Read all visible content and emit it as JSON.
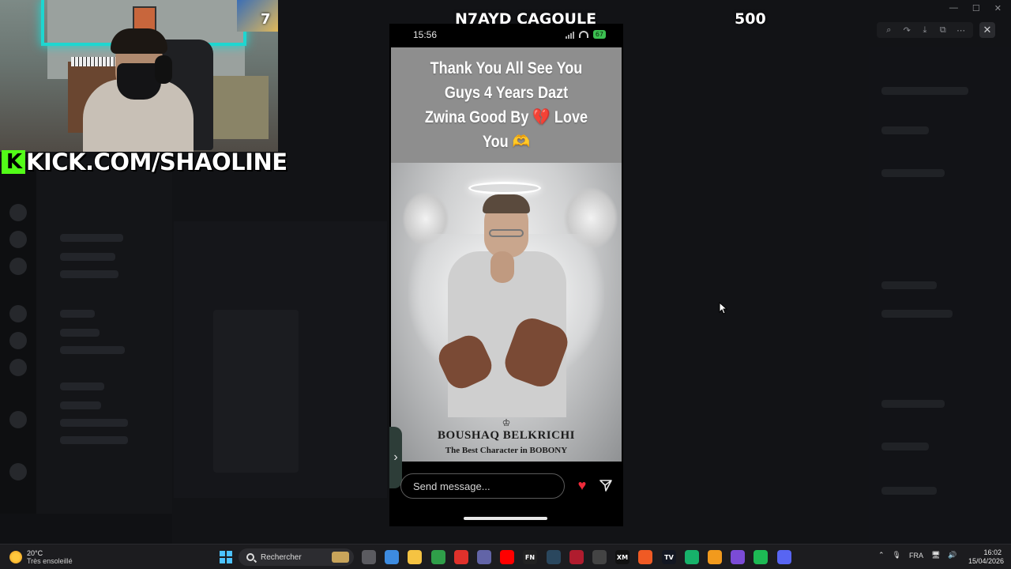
{
  "stream": {
    "title": "N7AYD CAGOULE",
    "count": "500",
    "webcam_badge": "7",
    "kick_logo": "K",
    "kick_url": "KICK.COM/SHAOLINE",
    "accent": "#53fc18"
  },
  "viewer": {
    "toolbar": [
      {
        "name": "zoom-icon",
        "glyph": "⌕"
      },
      {
        "name": "forward-icon",
        "glyph": "↷"
      },
      {
        "name": "download-icon",
        "glyph": "⤓"
      },
      {
        "name": "open-external-icon",
        "glyph": "⧉"
      },
      {
        "name": "more-icon",
        "glyph": "⋯"
      }
    ],
    "close_glyph": "✕"
  },
  "phone": {
    "status_time": "15:56",
    "battery": "67"
  },
  "story": {
    "caption": "Thank You All See You Guys 4 Years Dazt Zwina Good By 💔 Love You 🫶",
    "brand_crest": "♔",
    "brand_name": "BOUSHAQ BELKRICHI",
    "brand_subtitle": "The Best Character in BOBONY",
    "side_arrow": "›"
  },
  "message_bar": {
    "placeholder": "Send message...",
    "like_glyph": "♥",
    "like_color": "#ef2a3a"
  },
  "taskbar": {
    "weather_temp": "20°C",
    "weather_desc": "Très ensoleillé",
    "search_text": "Rechercher",
    "language": "FRA",
    "time": "16:02",
    "date": "15/04/2026",
    "tray_chevron": "⌃",
    "apps": [
      {
        "name": "task-view-icon",
        "color": "#5b5b60",
        "label": ""
      },
      {
        "name": "copilot-icon",
        "color": "#3d8be0",
        "label": ""
      },
      {
        "name": "file-explorer-icon",
        "color": "#f5c342",
        "label": ""
      },
      {
        "name": "chrome-icon",
        "color": "#2f9e49",
        "label": ""
      },
      {
        "name": "adobe-icon",
        "color": "#e0312b",
        "label": ""
      },
      {
        "name": "teams-icon",
        "color": "#6264a7",
        "label": ""
      },
      {
        "name": "youtube-icon",
        "color": "#ff0000",
        "label": ""
      },
      {
        "name": "app-fn-icon",
        "color": "#222",
        "label": "FN"
      },
      {
        "name": "steam-icon",
        "color": "#2a475e",
        "label": ""
      },
      {
        "name": "app-red-icon",
        "color": "#b01c2e",
        "label": ""
      },
      {
        "name": "app-refresh-icon",
        "color": "#444",
        "label": ""
      },
      {
        "name": "app-xm-icon",
        "color": "#111",
        "label": "XM"
      },
      {
        "name": "brave-icon",
        "color": "#f05a24",
        "label": ""
      },
      {
        "name": "tradingview-icon",
        "color": "#131722",
        "label": "TV"
      },
      {
        "name": "app-green-icon",
        "color": "#17b26a",
        "label": ""
      },
      {
        "name": "fl-studio-icon",
        "color": "#f29a1d",
        "label": ""
      },
      {
        "name": "obs-icon",
        "color": "#7b4bd6",
        "label": ""
      },
      {
        "name": "spotify-icon",
        "color": "#1db954",
        "label": ""
      },
      {
        "name": "discord-icon",
        "color": "#5865f2",
        "label": ""
      }
    ]
  }
}
